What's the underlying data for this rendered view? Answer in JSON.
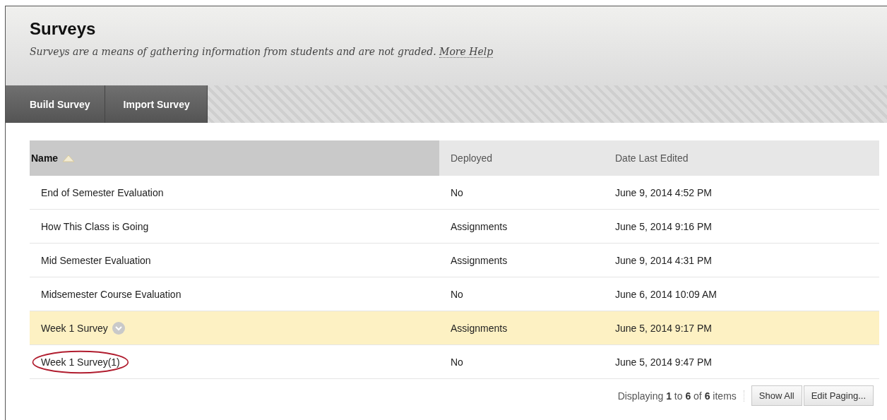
{
  "page": {
    "title": "Surveys",
    "description": "Surveys are a means of gathering information from students and are not graded.",
    "help_link": "More Help"
  },
  "action_bar": [
    {
      "label": "Build Survey"
    },
    {
      "label": "Import Survey"
    }
  ],
  "table": {
    "columns": [
      {
        "label": "Name",
        "sorted": true
      },
      {
        "label": "Deployed",
        "sorted": false
      },
      {
        "label": "Date Last Edited",
        "sorted": false
      }
    ],
    "rows": [
      {
        "name": "End of Semester Evaluation",
        "deployed": "No",
        "date": "June 9, 2014 4:52 PM",
        "highlighted": false,
        "circled": false
      },
      {
        "name": "How This Class is Going",
        "deployed": "Assignments",
        "date": "June 5, 2014 9:16 PM",
        "highlighted": false,
        "circled": false
      },
      {
        "name": "Mid Semester Evaluation",
        "deployed": "Assignments",
        "date": "June 9, 2014 4:31 PM",
        "highlighted": false,
        "circled": false
      },
      {
        "name": "Midsemester Course Evaluation",
        "deployed": "No",
        "date": "June 6, 2014 10:09 AM",
        "highlighted": false,
        "circled": false
      },
      {
        "name": "Week 1 Survey",
        "deployed": "Assignments",
        "date": "June 5, 2014 9:17 PM",
        "highlighted": true,
        "circled": false
      },
      {
        "name": "Week 1 Survey(1)",
        "deployed": "No",
        "date": "June 5, 2014 9:47 PM",
        "highlighted": false,
        "circled": true
      }
    ]
  },
  "paging": {
    "summary": "Displaying **1** to **6** of **6** items",
    "buttons": [
      "Show All",
      "Edit Paging..."
    ]
  }
}
